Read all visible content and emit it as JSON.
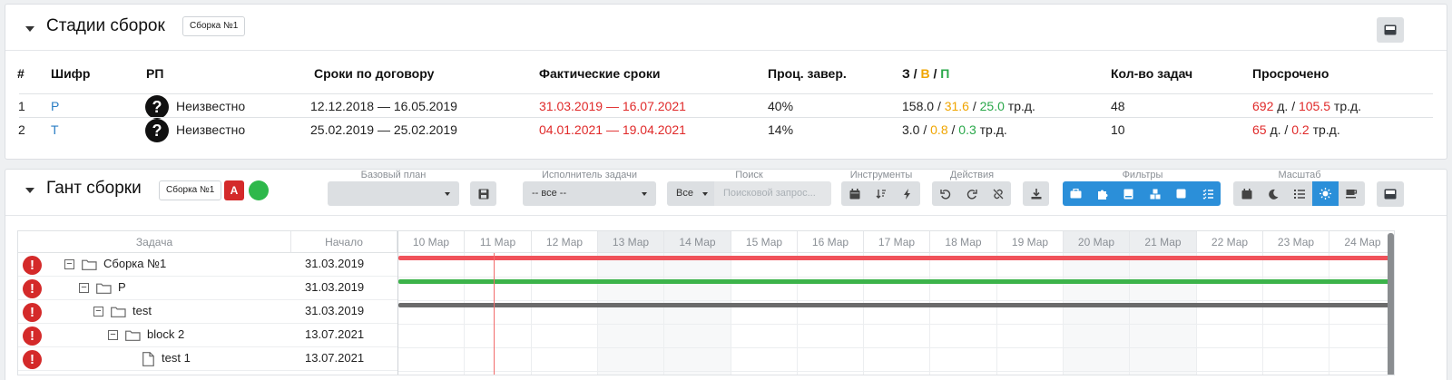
{
  "stages_panel": {
    "title": "Стадии сборок",
    "tag": "Сборка №1",
    "columns": [
      "#",
      "Шифр",
      "РП",
      "Сроки по договору",
      "Фактические сроки",
      "Проц. завер.",
      "З",
      "В",
      "П",
      "Кол-во задач",
      "Просрочено"
    ],
    "slash": "/",
    "rows": [
      {
        "num": "1",
        "code": "Р",
        "rp": "Неизвестно",
        "contract": "12.12.2018 — 16.05.2019",
        "actual": "31.03.2019 — 16.07.2021",
        "percent": "40%",
        "z": "158.0",
        "v": "31.6",
        "p": "25.0",
        "unit": "тр.д.",
        "tasks": "48",
        "overdue_days": "692",
        "overdue_days_unit": "д.",
        "overdue_labor": "105.5",
        "overdue_labor_unit": "тр.д."
      },
      {
        "num": "2",
        "code": "Т",
        "rp": "Неизвестно",
        "contract": "25.02.2019 — 25.02.2019",
        "actual": "04.01.2021 — 19.04.2021",
        "percent": "14%",
        "z": "3.0",
        "v": "0.8",
        "p": "0.3",
        "unit": "тр.д.",
        "tasks": "10",
        "overdue_days": "65",
        "overdue_days_unit": "д.",
        "overdue_labor": "0.2",
        "overdue_labor_unit": "тр.д."
      }
    ]
  },
  "gantt_panel": {
    "title": "Гант сборки",
    "tag": "Сборка №1",
    "badge": "A",
    "toolbar": {
      "base_plan_label": "Базовый план",
      "base_plan_value": "",
      "executor_label": "Исполнитель задачи",
      "executor_value": "-- все --",
      "search_label": "Поиск",
      "search_scope": "Все",
      "search_placeholder": "Поисковой запрос...",
      "tools_label": "Инструменты",
      "actions_label": "Действия",
      "filters_label": "Фильтры",
      "scale_label": "Масштаб"
    },
    "grid": {
      "col_task": "Задача",
      "col_start": "Начало",
      "days": [
        "10 Мар",
        "11 Мар",
        "12 Мар",
        "13 Мар",
        "14 Мар",
        "15 Мар",
        "16 Мар",
        "17 Мар",
        "18 Мар",
        "19 Мар",
        "20 Мар",
        "21 Мар",
        "22 Мар",
        "23 Мар",
        "24 Мар"
      ],
      "tasks": [
        {
          "name": "Сборка №1",
          "start": "31.03.2019"
        },
        {
          "name": "Р",
          "start": "31.03.2019"
        },
        {
          "name": "test",
          "start": "31.03.2019"
        },
        {
          "name": "block 2",
          "start": "13.07.2021"
        },
        {
          "name": "test 1",
          "start": "13.07.2021"
        }
      ],
      "alert_glyph": "!",
      "bar_colors": [
        "#f0525a",
        "#3cb34a",
        "#6b6b6b"
      ],
      "today_line_color": "#f26b6b"
    }
  }
}
